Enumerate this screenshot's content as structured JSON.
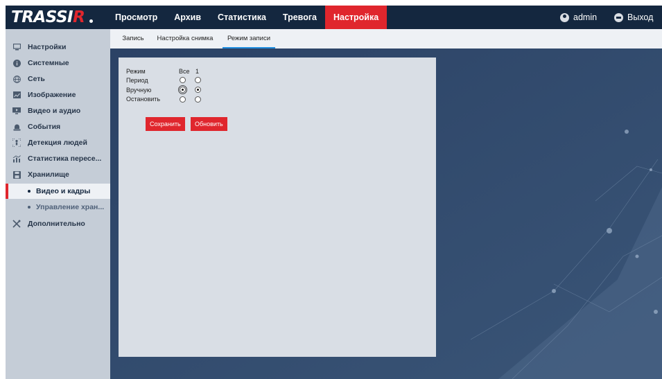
{
  "app": {
    "logo": {
      "main": "TRASSI",
      "accent": "R"
    },
    "nav": [
      "Просмотр",
      "Архив",
      "Статистика",
      "Тревога",
      "Настройка"
    ],
    "nav_active": "Настройка",
    "user": {
      "name": "admin",
      "icon": "user-icon"
    },
    "logout": {
      "label": "Выход",
      "icon": "logout-icon"
    }
  },
  "colors": {
    "accent": "#e0262d",
    "topbar": "#14273f",
    "sidebar": "#c5cdd7",
    "panel": "#d9dee5",
    "tab_underline": "#1f8ee0"
  },
  "sidebar": {
    "items": [
      {
        "label": "Настройки",
        "icon": "monitor-icon"
      },
      {
        "label": "Системные",
        "icon": "info-icon"
      },
      {
        "label": "Сеть",
        "icon": "globe-icon"
      },
      {
        "label": "Изображение",
        "icon": "image-icon"
      },
      {
        "label": "Видео и аудио",
        "icon": "video-icon"
      },
      {
        "label": "События",
        "icon": "alarm-icon"
      },
      {
        "label": "Детекция людей",
        "icon": "person-detection-icon"
      },
      {
        "label": "Статистика пересе...",
        "icon": "chart-icon"
      },
      {
        "label": "Хранилище",
        "icon": "save-icon"
      }
    ],
    "subitems": [
      {
        "label": "Видео и кадры",
        "active": true
      },
      {
        "label": "Управление хран...",
        "active": false
      }
    ],
    "extra": {
      "label": "Дополнительно",
      "icon": "tools-icon"
    }
  },
  "tabs": [
    {
      "label": "Запись",
      "active": false
    },
    {
      "label": "Настройка снимка",
      "active": false
    },
    {
      "label": "Режим записи",
      "active": true
    }
  ],
  "record_mode": {
    "header_label": "Режим",
    "col_all": "Все",
    "col_1": "1",
    "rows": [
      {
        "label": "Период",
        "all": false,
        "ch1": false
      },
      {
        "label": "Вручную",
        "all": true,
        "ch1": true
      },
      {
        "label": "Остановить",
        "all": false,
        "ch1": false
      }
    ]
  },
  "buttons": {
    "save": "Сохранить",
    "refresh": "Обновить"
  }
}
